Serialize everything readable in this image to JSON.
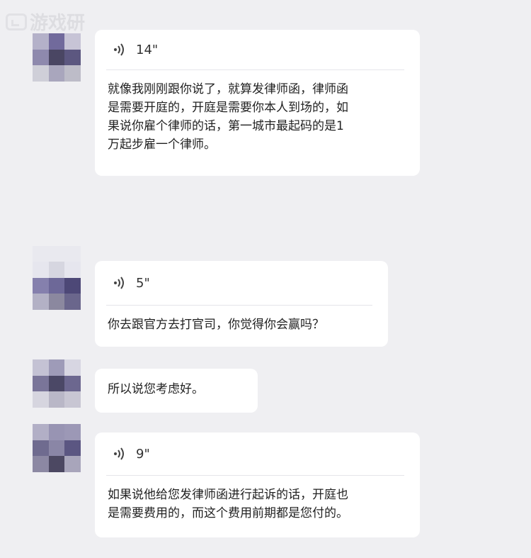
{
  "watermark": {
    "text": "游戏研"
  },
  "messages": [
    {
      "type": "voice",
      "duration": "14\"",
      "text": "就像我刚刚跟你说了，就算发律师函，律师函\n是需要开庭的，开庭是需要你本人到场的，如\n果说你雇个律师的话，第一城市最起码的是1\n万起步雇一个律师。"
    },
    {
      "type": "voice",
      "duration": "5\"",
      "text": "你去跟官方去打官司，你觉得你会赢吗？"
    },
    {
      "type": "text",
      "text": "所以说您考虑好。"
    },
    {
      "type": "voice",
      "duration": "9\"",
      "text": "如果说他给您发律师函进行起诉的话，开庭也\n是需要费用的，而这个费用前期都是您付的。"
    }
  ],
  "avatars": [
    {
      "colors": [
        "#b4b1c9",
        "#716a9c",
        "#c7c4d6",
        "#8e89ad",
        "#4a4663",
        "#5c5780",
        "#cfcfd8",
        "#a9a6bd",
        "#bdbcc8"
      ]
    },
    {
      "colors": [
        "#e6e6ee",
        "#d6d6e0",
        "#e6e6ee",
        "#8580ad",
        "#6d6898",
        "#4d4877",
        "#b3b1c5",
        "#8b889f",
        "#6a668c"
      ]
    },
    {
      "colors": [
        "#c4c2d4",
        "#9e9bb8",
        "#d7d6e2",
        "#7a7599",
        "#4b4866",
        "#6c678f",
        "#d6d5df",
        "#b9b7c7",
        "#c8c6d3"
      ]
    },
    {
      "colors": [
        "#b2afc6",
        "#9894b3",
        "#9c98b6",
        "#6f6b8f",
        "#8a86a6",
        "#5b5682",
        "#8c88a3",
        "#4c4862",
        "#a8a5bb"
      ]
    }
  ]
}
